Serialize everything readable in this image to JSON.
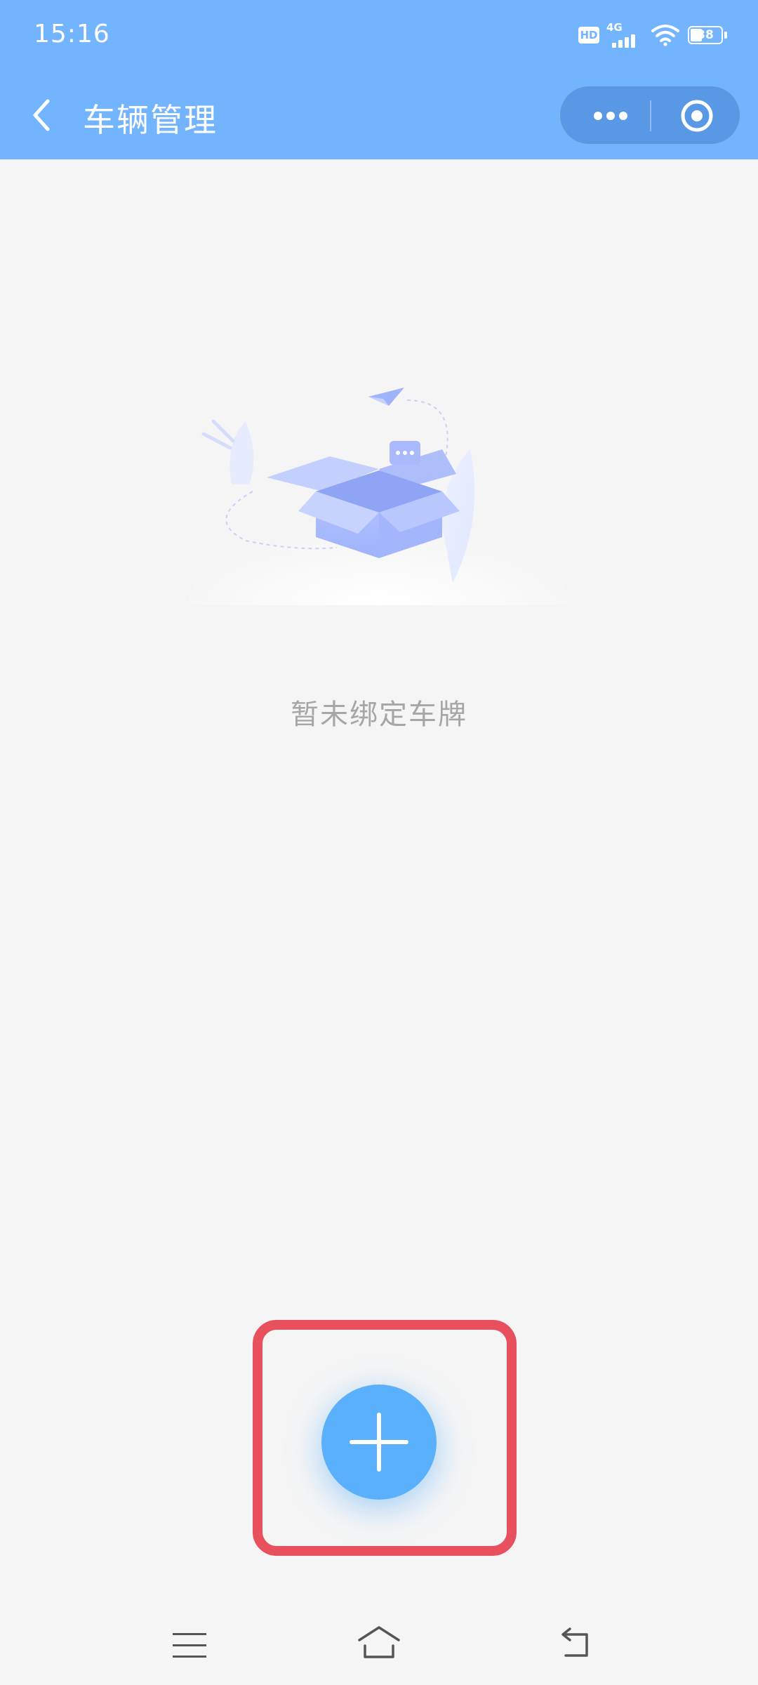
{
  "status_bar": {
    "time": "15:16",
    "hd": "HD",
    "network": "4G",
    "battery": "38"
  },
  "nav_bar": {
    "title": "车辆管理",
    "back_icon": "chevron-left-icon",
    "more_icon": "more-dots-icon",
    "close_icon": "target-close-icon"
  },
  "main": {
    "empty_illustration": "empty-box-icon",
    "empty_text": "暂未绑定车牌",
    "add_button_icon": "plus-icon"
  },
  "colors": {
    "header_bg": "#72b4fd",
    "page_bg": "#f5f5f5",
    "add_button": "#5bb0fb",
    "highlight": "#e8505e",
    "empty_text": "#a6a6a6"
  },
  "system_nav": {
    "menu_icon": "menu-icon",
    "home_icon": "home-icon",
    "back_icon": "back-arrow-icon"
  }
}
